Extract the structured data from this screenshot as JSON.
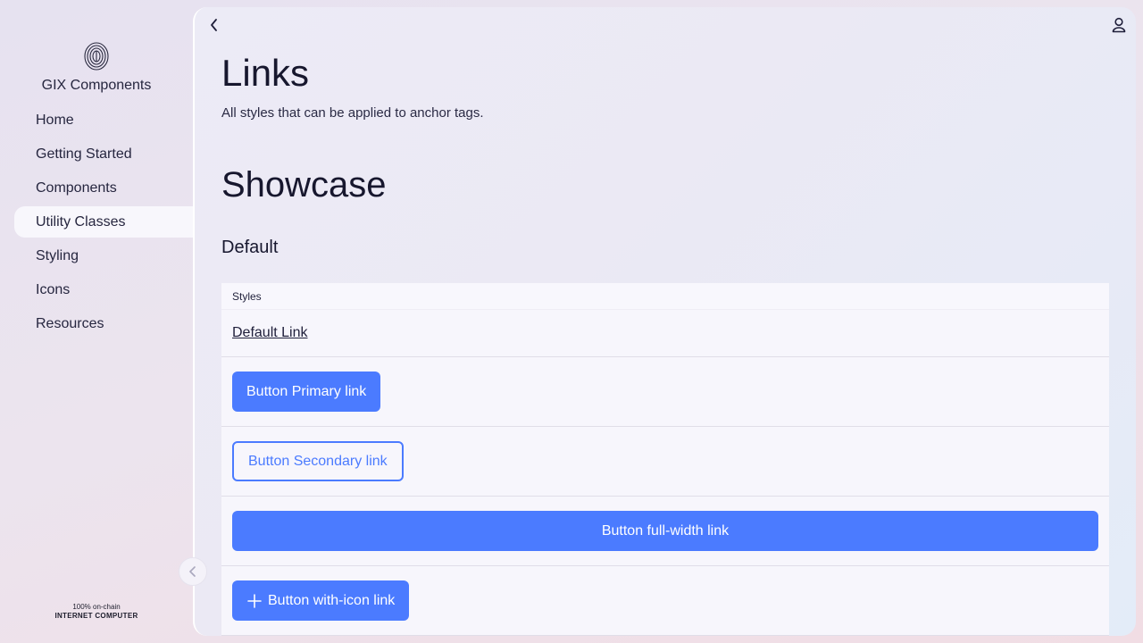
{
  "brand": {
    "name": "GIX Components",
    "logo_icon": "fingerprint-logo-icon"
  },
  "sidebar": {
    "items": [
      {
        "label": "Home"
      },
      {
        "label": "Getting Started"
      },
      {
        "label": "Components"
      },
      {
        "label": "Utility Classes",
        "active": true
      },
      {
        "label": "Styling"
      },
      {
        "label": "Icons"
      },
      {
        "label": "Resources"
      }
    ],
    "footer": {
      "line1": "100% on-chain",
      "line2": "INTERNET COMPUTER"
    }
  },
  "header": {
    "back_icon": "chevron-left-icon",
    "user_icon": "user-icon"
  },
  "main": {
    "title": "Links",
    "subtitle": "All styles that can be applied to anchor tags.",
    "section_title": "Showcase",
    "sub_title": "Default",
    "table": {
      "header": "Styles",
      "rows": [
        {
          "label": "Default Link"
        },
        {
          "label": "Button Primary link"
        },
        {
          "label": "Button Secondary link"
        },
        {
          "label": "Button full-width link"
        },
        {
          "label": "Button with-icon link",
          "icon": "plus-icon"
        }
      ]
    }
  },
  "colors": {
    "primary": "#4b7bff",
    "text": "#17172e",
    "active_bg": "#f8f7fc"
  }
}
